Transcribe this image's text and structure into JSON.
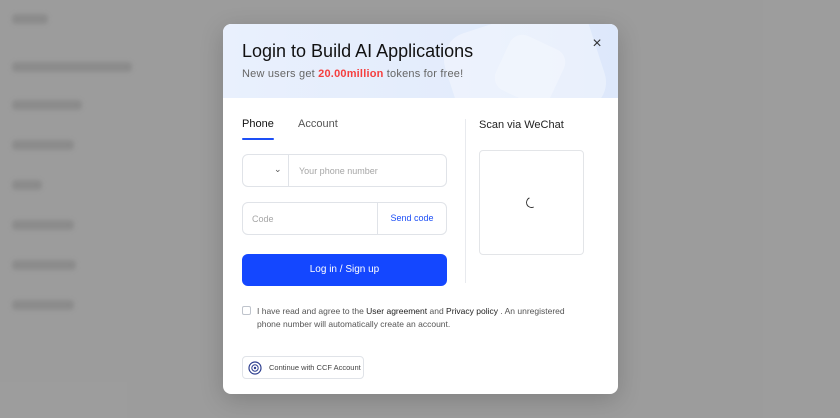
{
  "modal": {
    "title": "Login to Build AI Applications",
    "subtitle_prefix": "New users get ",
    "subtitle_highlight": "20.00million",
    "subtitle_suffix": " tokens for free!",
    "close_icon": "×"
  },
  "tabs": [
    {
      "label": "Phone",
      "active": true
    },
    {
      "label": "Account",
      "active": false
    }
  ],
  "phone": {
    "chevron": "⌄",
    "placeholder": "Your phone number"
  },
  "code": {
    "placeholder": "Code",
    "send_label": "Send code"
  },
  "login_button": "Log in / Sign up",
  "agreement": {
    "prefix": "I have read and agree to the ",
    "user_agreement": "User agreement",
    "and": " and ",
    "privacy_policy": "Privacy policy",
    "suffix": " . An unregistered phone number will automatically create an account."
  },
  "ccf_button": "Continue with CCF Account",
  "wechat": {
    "title": "Scan via WeChat"
  },
  "colors": {
    "accent": "#1447ff",
    "highlight": "#f53f3f",
    "link": "#1d4ff6"
  }
}
